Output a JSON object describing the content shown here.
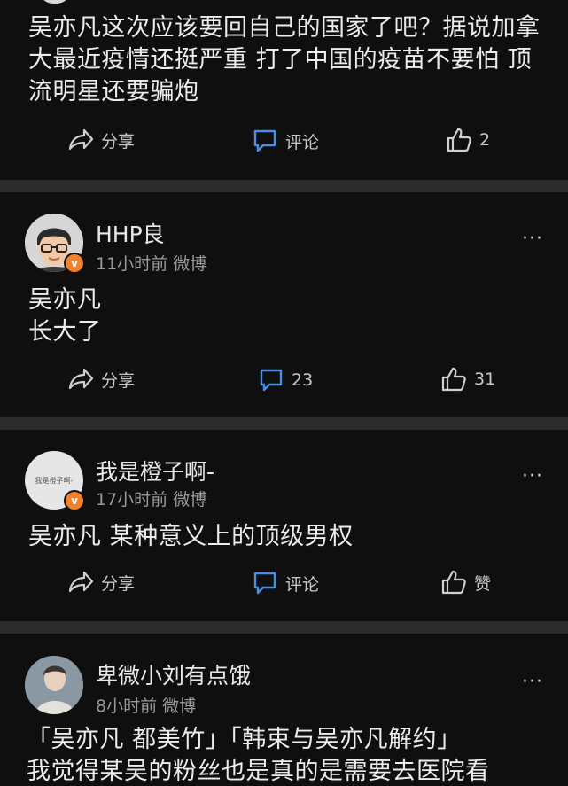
{
  "colors": {
    "background": "#000000",
    "card": "#0f0f0f",
    "divider": "#2b2b2b",
    "accent_blue": "#4a90e2",
    "verified": "#f5802a"
  },
  "posts": [
    {
      "text": "吴亦凡这次应该要回自己的国家了吧？据说加拿大最近疫情还挺严重 打了中国的疫苗不要怕 顶流明星还要骗炮",
      "actions": {
        "share": "分享",
        "comment": "评论",
        "like": "2"
      }
    },
    {
      "username": "HHP良",
      "meta": "11小时前 微博",
      "text_lines": [
        "吴亦凡",
        "长大了"
      ],
      "actions": {
        "share": "分享",
        "comment": "23",
        "like": "31"
      }
    },
    {
      "username": "我是橙子啊-",
      "meta": "17小时前 微博",
      "avatar_text": "我是橙子啊-",
      "text": "吴亦凡 某种意义上的顶级男权",
      "actions": {
        "share": "分享",
        "comment": "评论",
        "like": "赞"
      }
    },
    {
      "username": "卑微小刘有点饿",
      "meta": "8小时前 微博",
      "text_lines": [
        "「吴亦凡 都美竹」「韩束与吴亦凡解约」",
        "我觉得某吴的粉丝也是真的是需要去医院看"
      ]
    }
  ],
  "more_label": "···"
}
